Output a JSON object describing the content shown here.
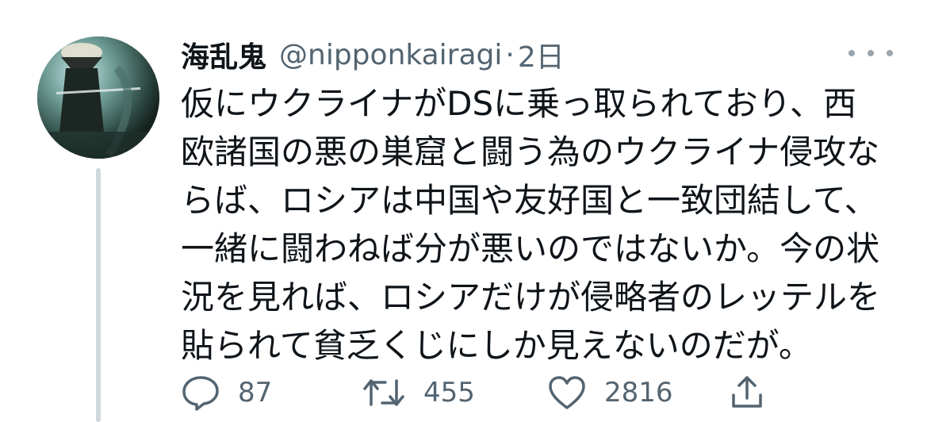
{
  "tweet": {
    "author_name": "海乱鬼",
    "handle": "@nipponkairagi",
    "separator": "·",
    "time": "2日",
    "body_lines": [
      "仮にウクライナがDSに乗っ取られており、西",
      "欧諸国の悪の巣窟と闘う為のウクライナ侵攻な",
      "らば、ロシアは中国や友好国と一致団結して、",
      "一緒に闘わねば分が悪いのではないか。今の状",
      "況を見れば、ロシアだけが侵略者のレッテルを",
      "貼られて貧乏くじにしか見えないのだが。"
    ],
    "actions": {
      "reply_count": "87",
      "retweet_count": "455",
      "like_count": "2816"
    }
  },
  "icons": {
    "reply": "speech-bubble-icon",
    "retweet": "retweet-arrows-icon",
    "like": "heart-icon",
    "share": "share-upload-icon",
    "more": "more-dots-icon"
  },
  "colors": {
    "text_primary": "#0f1419",
    "text_secondary": "#536471",
    "thread_line": "#cfd9de"
  }
}
